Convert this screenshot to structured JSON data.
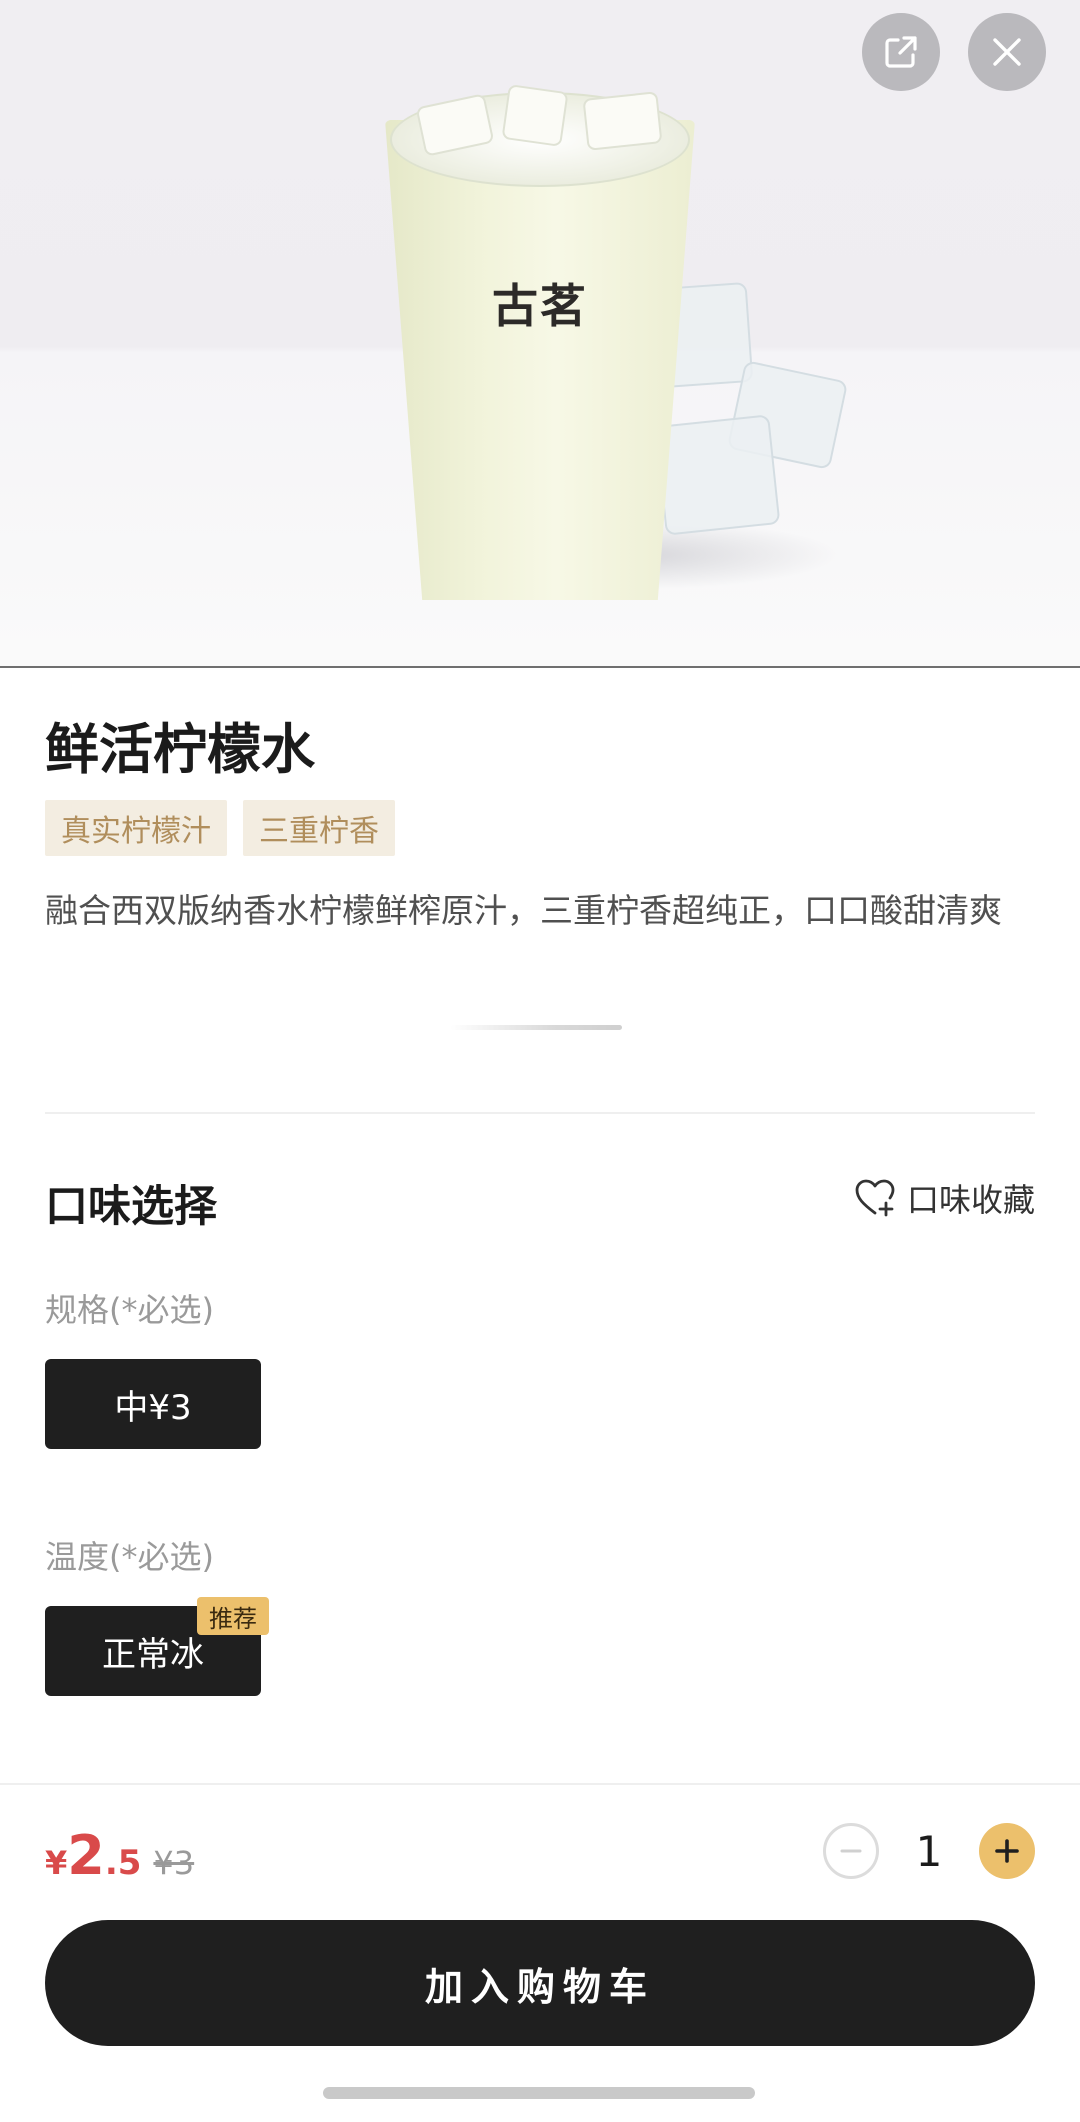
{
  "hero": {
    "cup_brand": "古茗",
    "share_icon": "share-external-icon",
    "close_icon": "close-icon"
  },
  "product": {
    "title": "鲜活柠檬水",
    "tags": [
      "真实柠檬汁",
      "三重柠香"
    ],
    "description": "融合西双版纳香水柠檬鲜榨原汁，三重柠香超纯正，口口酸甜清爽"
  },
  "options": {
    "section_title": "口味选择",
    "favorite_label": "口味收藏",
    "favorite_icon": "heart-plus-icon",
    "size": {
      "label": "规格(*必选)",
      "selected": "中¥3"
    },
    "temperature": {
      "label": "温度(*必选)",
      "selected": "正常冰",
      "badge": "推荐"
    }
  },
  "bottom": {
    "currency": "¥",
    "price_int": "2",
    "price_dec": ".5",
    "original_price": "¥3",
    "quantity": "1",
    "add_to_cart": "加入购物车"
  },
  "colors": {
    "accent": "#ecc06c",
    "price": "#d94a4a",
    "tag_bg": "#f3ede1",
    "tag_text": "#b08e5c",
    "dark": "#1f1f1f"
  }
}
